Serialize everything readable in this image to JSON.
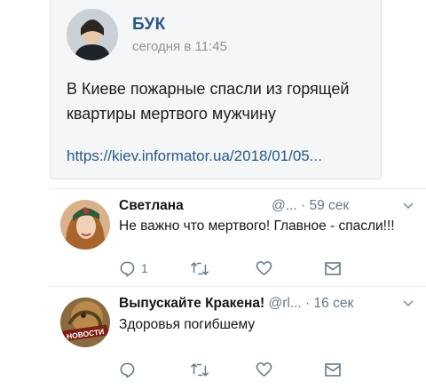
{
  "quoted_post": {
    "author": "БУК",
    "time": "сегодня в 11:45",
    "text": "В Киеве пожарные спасли из горящей квартиры мертвого мужчину",
    "link": "https://kiev.informator.ua/2018/01/05..."
  },
  "replies": [
    {
      "name": "Светлана",
      "handle": "@...",
      "separator": "·",
      "age": "59 сек",
      "text": "Не важно что мертвого! Главное - спасли!!!",
      "reply_count": "1",
      "retweet_count": "",
      "like_count": ""
    },
    {
      "name": "Выпускайте Кракена!",
      "handle": "@rl...",
      "separator": "·",
      "age": "16 сек",
      "text": "Здоровья погибшему",
      "reply_count": "",
      "retweet_count": "",
      "like_count": "",
      "avatar_text": "НОВОСТИ"
    }
  ],
  "icons": {
    "reply": "comment-bubble-icon",
    "retweet": "retweet-icon",
    "like": "heart-icon",
    "dm": "envelope-icon",
    "menu": "chevron-down-icon"
  },
  "colors": {
    "vk_link": "#2a5885",
    "secondary_text": "#657786",
    "card_background": "#f4f6f8"
  }
}
